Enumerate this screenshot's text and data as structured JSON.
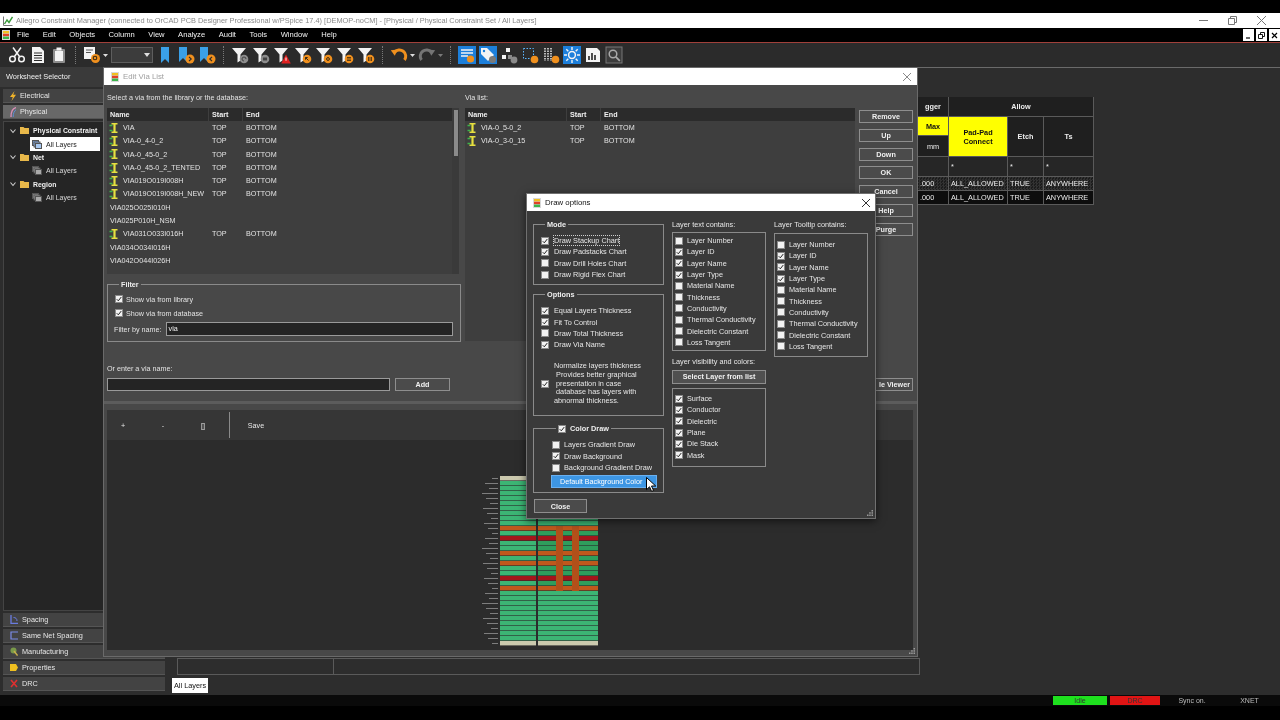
{
  "window": {
    "title": "Allegro Constraint Manager (connected to OrCAD PCB Designer Professional w/PSpice 17.4) [DEMOP-noCM] - [Physical / Physical Constraint Set / All Layers]"
  },
  "menu": [
    "File",
    "Edit",
    "Objects",
    "Column",
    "View",
    "Analyze",
    "Audit",
    "Tools",
    "Window",
    "Help"
  ],
  "toolbar": [
    {
      "pressed": false,
      "disabled": false
    },
    {
      "pressed": false,
      "disabled": false
    },
    {
      "pressed": false,
      "disabled": false
    },
    {
      "pressed": false,
      "disabled": false
    },
    {
      "pressed": false,
      "disabled": false
    },
    {
      "pressed": false,
      "disabled": false
    },
    {
      "pressed": false,
      "disabled": false
    },
    {
      "pressed": false,
      "disabled": false
    },
    {
      "pressed": false,
      "disabled": false
    },
    {
      "pressed": false,
      "disabled": false
    },
    {
      "pressed": false,
      "disabled": false
    },
    {
      "pressed": false,
      "disabled": false
    },
    {
      "pressed": false,
      "disabled": false
    },
    {
      "pressed": false,
      "disabled": false
    },
    {
      "pressed": false,
      "disabled": false
    },
    {
      "pressed": false,
      "disabled": true
    },
    {
      "pressed": true,
      "disabled": false
    },
    {
      "pressed": true,
      "disabled": false
    },
    {
      "pressed": false,
      "disabled": false
    },
    {
      "pressed": false,
      "disabled": false
    },
    {
      "pressed": false,
      "disabled": false
    },
    {
      "pressed": true,
      "disabled": false
    },
    {
      "pressed": false,
      "disabled": false
    },
    {
      "pressed": false,
      "disabled": false
    }
  ],
  "worksheet_selector": {
    "title": "Worksheet Selector",
    "domains": [
      {
        "label": "Electrical",
        "selected": false,
        "expanded": false
      },
      {
        "label": "Physical",
        "selected": true,
        "expanded": true,
        "worksheets": [
          {
            "label": "Physical Constraint",
            "selected": false,
            "expanded": true,
            "children": [
              {
                "label": "All Layers",
                "selected": true
              }
            ]
          },
          {
            "label": "Net",
            "selected": false,
            "expanded": true,
            "children": [
              {
                "label": "All Layers",
                "selected": false
              }
            ]
          },
          {
            "label": "Region",
            "selected": false,
            "expanded": true,
            "children": [
              {
                "label": "All Layers",
                "selected": false
              }
            ]
          }
        ]
      },
      {
        "label": "Spacing",
        "selected": false,
        "expanded": false
      },
      {
        "label": "Same Net Spacing",
        "selected": false,
        "expanded": false
      },
      {
        "label": "Manufacturing",
        "selected": false,
        "expanded": false
      },
      {
        "label": "Properties",
        "selected": false,
        "expanded": false
      },
      {
        "label": "DRC",
        "selected": false,
        "expanded": false
      }
    ]
  },
  "constraint_grid": {
    "column_groups": [
      {
        "label": "gger",
        "columns": [
          {
            "label": "Max",
            "unit": "mm",
            "highlighted": true
          }
        ]
      },
      {
        "label": "Allow",
        "columns": [
          {
            "label": "Pad-Pad Connect",
            "highlighted": true
          },
          {
            "label": "Etch",
            "highlighted": false
          },
          {
            "label": "Ts",
            "highlighted": false
          }
        ]
      }
    ],
    "rows": [
      {
        "kind": "filter",
        "cells": [
          null,
          "*",
          "*",
          "*"
        ]
      },
      {
        "kind": "hatched",
        "cells": [
          ".000",
          "ALL_ALLOWED",
          "TRUE",
          "ANYWHERE"
        ]
      },
      {
        "kind": "plain",
        "cells": [
          ".000",
          "ALL_ALLOWED",
          "TRUE",
          "ANYWHERE"
        ]
      }
    ]
  },
  "sheet_tabs": [
    {
      "label": "All Layers",
      "selected": true
    }
  ],
  "status_bar": {
    "indicators": [
      {
        "label": "Idle",
        "color": "#1ee01e"
      },
      {
        "label": "DRC",
        "color": "#e01414"
      }
    ],
    "items": [
      "Sync on.",
      "XNET"
    ]
  },
  "edit_via_list": {
    "title": "Edit Via List",
    "library_label": "Select a via from the library or the database:",
    "library": {
      "columns": [
        "Name",
        "Start",
        "End"
      ],
      "rows": [
        {
          "kind": "database",
          "name": "VIA",
          "start": "TOP",
          "end": "BOTTOM"
        },
        {
          "kind": "database",
          "name": "VIA-0_4-0_2",
          "start": "TOP",
          "end": "BOTTOM"
        },
        {
          "kind": "database",
          "name": "VIA-0_45-0_2",
          "start": "TOP",
          "end": "BOTTOM"
        },
        {
          "kind": "database",
          "name": "VIA-0_45-0_2_TENTED",
          "start": "TOP",
          "end": "BOTTOM"
        },
        {
          "kind": "database",
          "name": "VIA019O019I008H",
          "start": "TOP",
          "end": "BOTTOM"
        },
        {
          "kind": "database",
          "name": "VIA019O019I008H_NEW",
          "start": "TOP",
          "end": "BOTTOM"
        },
        {
          "kind": "library",
          "name": "VIA025O025I010H"
        },
        {
          "kind": "library",
          "name": "VIA025P010H_NSM"
        },
        {
          "kind": "database",
          "name": "VIA031O033I016H",
          "start": "TOP",
          "end": "BOTTOM"
        },
        {
          "kind": "library",
          "name": "VIA034O034I016H"
        },
        {
          "kind": "library",
          "name": "VIA042O044I026H"
        }
      ]
    },
    "filter": {
      "title": "Filter",
      "options": [
        {
          "label": "Show via from library",
          "checked": true
        },
        {
          "label": "Show via from database",
          "checked": true
        }
      ],
      "name_label": "Filter by name:",
      "name_value": "via"
    },
    "via_list_label": "Via list:",
    "via_list": {
      "columns": [
        "Name",
        "Start",
        "End"
      ],
      "rows": [
        {
          "kind": "database",
          "name": "VIA-0_5-0_2",
          "start": "TOP",
          "end": "BOTTOM"
        },
        {
          "kind": "database",
          "name": "VIA-0_3-0_15",
          "start": "TOP",
          "end": "BOTTOM"
        }
      ]
    },
    "buttons": [
      "Remove",
      "Up",
      "Down",
      "OK",
      "Cancel",
      "Help",
      "Purge"
    ],
    "entry_label": "Or enter a via name:",
    "add_button": "Add",
    "viewer_button": "le Viewer",
    "preview_tools": [
      [
        "+",
        "-",
        "[]"
      ],
      [
        "Save"
      ]
    ]
  },
  "draw_options": {
    "title": "Draw options",
    "mode": {
      "title": "Mode",
      "options": [
        {
          "label": "Draw Stackup Chart",
          "checked": true,
          "focused": true
        },
        {
          "label": "Draw Padstacks Chart",
          "checked": true,
          "focused": false
        },
        {
          "label": "Draw Drill Holes Chart",
          "checked": false,
          "focused": false
        },
        {
          "label": "Draw Rigid Flex Chart",
          "checked": false,
          "focused": false
        }
      ]
    },
    "options": {
      "title": "Options",
      "options": [
        {
          "kind": "check",
          "label": "Equal Layers Thickness",
          "checked": true
        },
        {
          "kind": "check",
          "label": "Fit To Control",
          "checked": true
        },
        {
          "kind": "check",
          "label": "Draw Total Thickness",
          "checked": false
        },
        {
          "kind": "check",
          "label": "Draw Via Name",
          "checked": true
        },
        {
          "kind": "note",
          "label": "Normalize layers thickness\n Provides better graphical\n presentation in case\n database has layers with\nabnormal thickness.",
          "checked": true
        }
      ]
    },
    "color_draw": {
      "title": "Color Draw",
      "checked": true,
      "options": [
        {
          "label": "Layers Gradient Draw",
          "checked": false
        },
        {
          "label": "Draw Background",
          "checked": true
        },
        {
          "label": "Background Gradient Draw",
          "checked": false
        }
      ],
      "button": {
        "label": "Default Background Color",
        "hovered": true
      }
    },
    "close_button": "Close",
    "layer_text": {
      "title": "Layer text contains:",
      "options": [
        {
          "label": "Layer Number",
          "checked": false
        },
        {
          "label": "Layer ID",
          "checked": true
        },
        {
          "label": "Layer Name",
          "checked": true
        },
        {
          "label": "Layer Type",
          "checked": true
        },
        {
          "label": "Material Name",
          "checked": false
        },
        {
          "label": "Thickness",
          "checked": false
        },
        {
          "label": "Conductivity",
          "checked": false
        },
        {
          "label": "Thermal Conductivity",
          "checked": false
        },
        {
          "label": "Dielectric Constant",
          "checked": false
        },
        {
          "label": "Loss Tangent",
          "checked": false
        }
      ]
    },
    "layer_visibility": {
      "title": "Layer visibility and colors:",
      "button": "Select Layer from list",
      "options": [
        {
          "label": "Surface",
          "checked": true
        },
        {
          "label": "Conductor",
          "checked": true
        },
        {
          "label": "Dielectric",
          "checked": true
        },
        {
          "label": "Plane",
          "checked": true
        },
        {
          "label": "Die Stack",
          "checked": true
        },
        {
          "label": "Mask",
          "checked": true
        }
      ]
    },
    "layer_tooltip": {
      "title": "Layer Tooltip contains:",
      "options": [
        {
          "label": "Layer Number",
          "checked": false
        },
        {
          "label": "Layer ID",
          "checked": true
        },
        {
          "label": "Layer Name",
          "checked": true
        },
        {
          "label": "Layer Type",
          "checked": true
        },
        {
          "label": "Material Name",
          "checked": false
        },
        {
          "label": "Thickness",
          "checked": false
        },
        {
          "label": "Conductivity",
          "checked": false
        },
        {
          "label": "Thermal Conductivity",
          "checked": false
        },
        {
          "label": "Dielectric Constant",
          "checked": false
        },
        {
          "label": "Loss Tangent",
          "checked": false
        }
      ]
    }
  }
}
